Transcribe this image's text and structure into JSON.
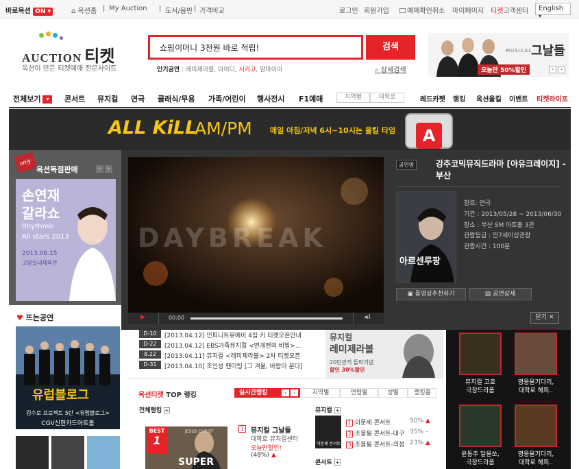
{
  "topbar": {
    "baro_label": "바로옥션",
    "on_label": "ON",
    "home": "옥션홈",
    "my_auction": "My Auction",
    "books": "도서/음반",
    "compare": "가격비교",
    "login": "로그인",
    "signup": "회원가입",
    "cancel": "예매확인취소",
    "mypage": "마이페이지",
    "cs_prefix": "티켓",
    "cs_suffix": "고객센터",
    "language": "English"
  },
  "header": {
    "logo_auction": "AUCTION",
    "logo_ticket": "티켓",
    "logo_sub": "옥션이 만든 티켓예매 전문사이트",
    "search_value": "쇼핑이머니 3천원 바로 적립!",
    "search_button": "검색",
    "popular_label": "인기공연",
    "popular_items": [
      "레미제라블",
      "아이디",
      "시카고",
      "맘마미아"
    ],
    "detail_search": "상세검색",
    "banner_musical": "MUSICAL",
    "banner_title": "그날들",
    "banner_discount": "오늘만 50%할인"
  },
  "nav": {
    "all": "전체보기",
    "items": [
      "콘서트",
      "뮤지컬",
      "연극",
      "클래식/무용",
      "가족/어린이",
      "행사전시",
      "F1예매"
    ],
    "region": "지역별",
    "university": "대학로",
    "right_items": [
      "레드카펫",
      "랭킹",
      "옥션올킬",
      "이벤트",
      "티켓라이프"
    ]
  },
  "allkill": {
    "title": "ALL KiLL",
    "ampm": "AM/PM",
    "desc": "매일 아침/저녁 6시~10시는 올킬 타임",
    "app_letter": "A"
  },
  "exclusive": {
    "badge": "only",
    "title": "옥션독점판매",
    "poster_line1": "손연재",
    "poster_line2": "갈라쇼",
    "poster_line3": "Rhythmic",
    "poster_line4": "All stars 2013",
    "poster_date": "2013.06.15",
    "poster_venue": "고양실내체육관"
  },
  "video": {
    "watermark": "DAYBREAK",
    "time": "00:00"
  },
  "show": {
    "tag": "공연명",
    "title": "강추코믹뮤직드라마 [아유크레이지] - 부산",
    "poster_title": "아르센루팡",
    "genre": "장르: 연극",
    "period": "기간 : 2013/05/28 ~ 2013/06/30",
    "venue": "장소 : 부산 SM 아트홀 3관",
    "rating": "관람등급 : 만7세이상관람",
    "duration": "관람시간 : 100분",
    "video_button": "동영상추천하기",
    "detail_button": "공연상세",
    "close_button": "닫기"
  },
  "hot": {
    "title": "뜨는공연",
    "poster_title": "유럽블로그",
    "poster_sub": "김수로 프로젝트 5탄 <유럽블로그>",
    "poster_venue": "CGV신한카드아트홀"
  },
  "notices": [
    {
      "dday": "D-10",
      "text": "[2013.04.12] 인피니트뮤에이 4집 키 티켓오픈안내"
    },
    {
      "dday": "D-22",
      "text": "[2013.04.12] EBS가족뮤지컬 <번개맨의 비밀>..."
    },
    {
      "dday": "8.22",
      "text": "[2013.04.11] 뮤지컬 <레미제라블> 2차 티켓오픈"
    },
    {
      "dday": "D-31",
      "text": "[2013.04.10] 조인성 팬미팅 [그 겨울, 바람이 분다]"
    }
  ],
  "lesmis": {
    "line1": "뮤지컬",
    "line2": "레미제라블",
    "sub": "20만관객 돌파기념",
    "discount": "할인 30%할인"
  },
  "ranking": {
    "title_prefix": "옥션티켓",
    "title_suffix": "TOP 랭킹",
    "tabs": [
      "실시간랭킹",
      "지역별",
      "연령별",
      "성별",
      "랭킹홈"
    ],
    "overall": "전체랭킹",
    "best_label": "BEST",
    "best_rank": "1",
    "poster_text": "SUPER",
    "poster_small": "JESUS CHRIST",
    "first_rank": "1",
    "first_title": "뮤지컬 그날들",
    "first_venue": "대학로 뮤지컬센터",
    "first_note": "오늘만할인!",
    "first_pct": "(48%)",
    "musical_label": "뮤지컬",
    "musical_items": [
      {
        "rank": "1",
        "name": "이문세 콘서트",
        "pct": "50%"
      },
      {
        "rank": "2",
        "name": "조용필 콘서트-대구",
        "pct": "35%"
      },
      {
        "rank": "3",
        "name": "조용필 콘서트-의정",
        "pct": "23%"
      }
    ],
    "concert_label": "콘서트",
    "thumb_label": "이문세 콘서트"
  },
  "right_thumbs": [
    {
      "label": "뮤지컬 고호"
    },
    {
      "label": "극장드라폼"
    },
    {
      "label": "영웅을기다리,"
    },
    {
      "label": "대학로 해피.."
    },
    {
      "label": "윤동주 달을쏘,"
    },
    {
      "label": "극장드라폼"
    },
    {
      "label": "영웅을기다리,"
    },
    {
      "label": "대학로 해피.."
    }
  ],
  "colors": {
    "accent": "#e5242a",
    "dark": "#2d2d2d"
  }
}
